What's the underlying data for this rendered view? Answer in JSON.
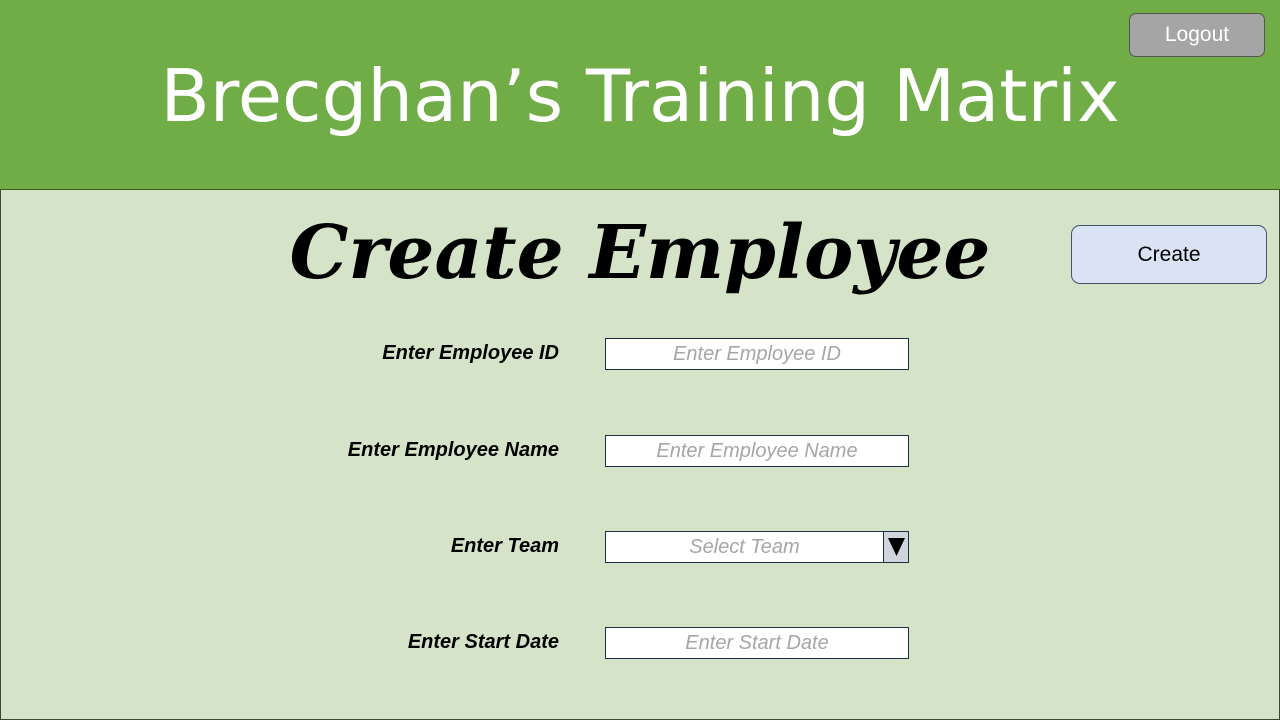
{
  "header": {
    "app_title": "Brecghan’s Training Matrix",
    "logout_label": "Logout"
  },
  "main": {
    "page_title": "Create Employee",
    "create_label": "Create",
    "form": {
      "employee_id": {
        "label": "Enter Employee ID",
        "placeholder": "Enter Employee ID",
        "value": ""
      },
      "employee_name": {
        "label": "Enter Employee Name",
        "placeholder": "Enter Employee Name",
        "value": ""
      },
      "team": {
        "label": "Enter Team",
        "placeholder": "Select Team",
        "dropdown_icon": "triangle-down-icon"
      },
      "start_date": {
        "label": "Enter Start Date",
        "placeholder": "Enter Start Date",
        "value": ""
      }
    }
  },
  "colors": {
    "header_bg": "#70ad47",
    "page_bg": "#d5e4c8",
    "logout_bg": "#a5a5a5",
    "create_bg": "#dae3f3"
  }
}
